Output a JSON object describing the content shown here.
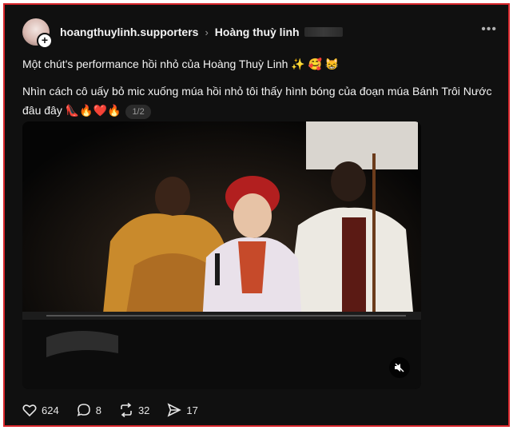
{
  "post": {
    "author": "hoangthuylinh.supporters",
    "topic": "Hoàng thuỳ linh",
    "line1": "Một chút's performance hồi nhỏ của Hoàng Thuỳ Linh ✨ 🥰 😸",
    "line2": "Nhìn cách cô uấy bỏ mic xuống múa hồi nhỏ tôi thấy hình bóng của đoạn múa Bánh Trôi Nước đâu đây 👠🔥❤️🔥",
    "pager": "1/2"
  },
  "icons": {
    "more": "more-icon",
    "chevron": "chevron-right-icon",
    "plus": "follow-plus-icon",
    "mute": "mute-icon",
    "like": "heart-icon",
    "comment": "comment-icon",
    "repost": "repost-icon",
    "share": "send-icon"
  },
  "stats": {
    "likes": "624",
    "comments": "8",
    "reposts": "32",
    "shares": "17"
  },
  "colors": {
    "background": "#101010",
    "border": "#d8262b",
    "text": "#f3f3f3"
  }
}
